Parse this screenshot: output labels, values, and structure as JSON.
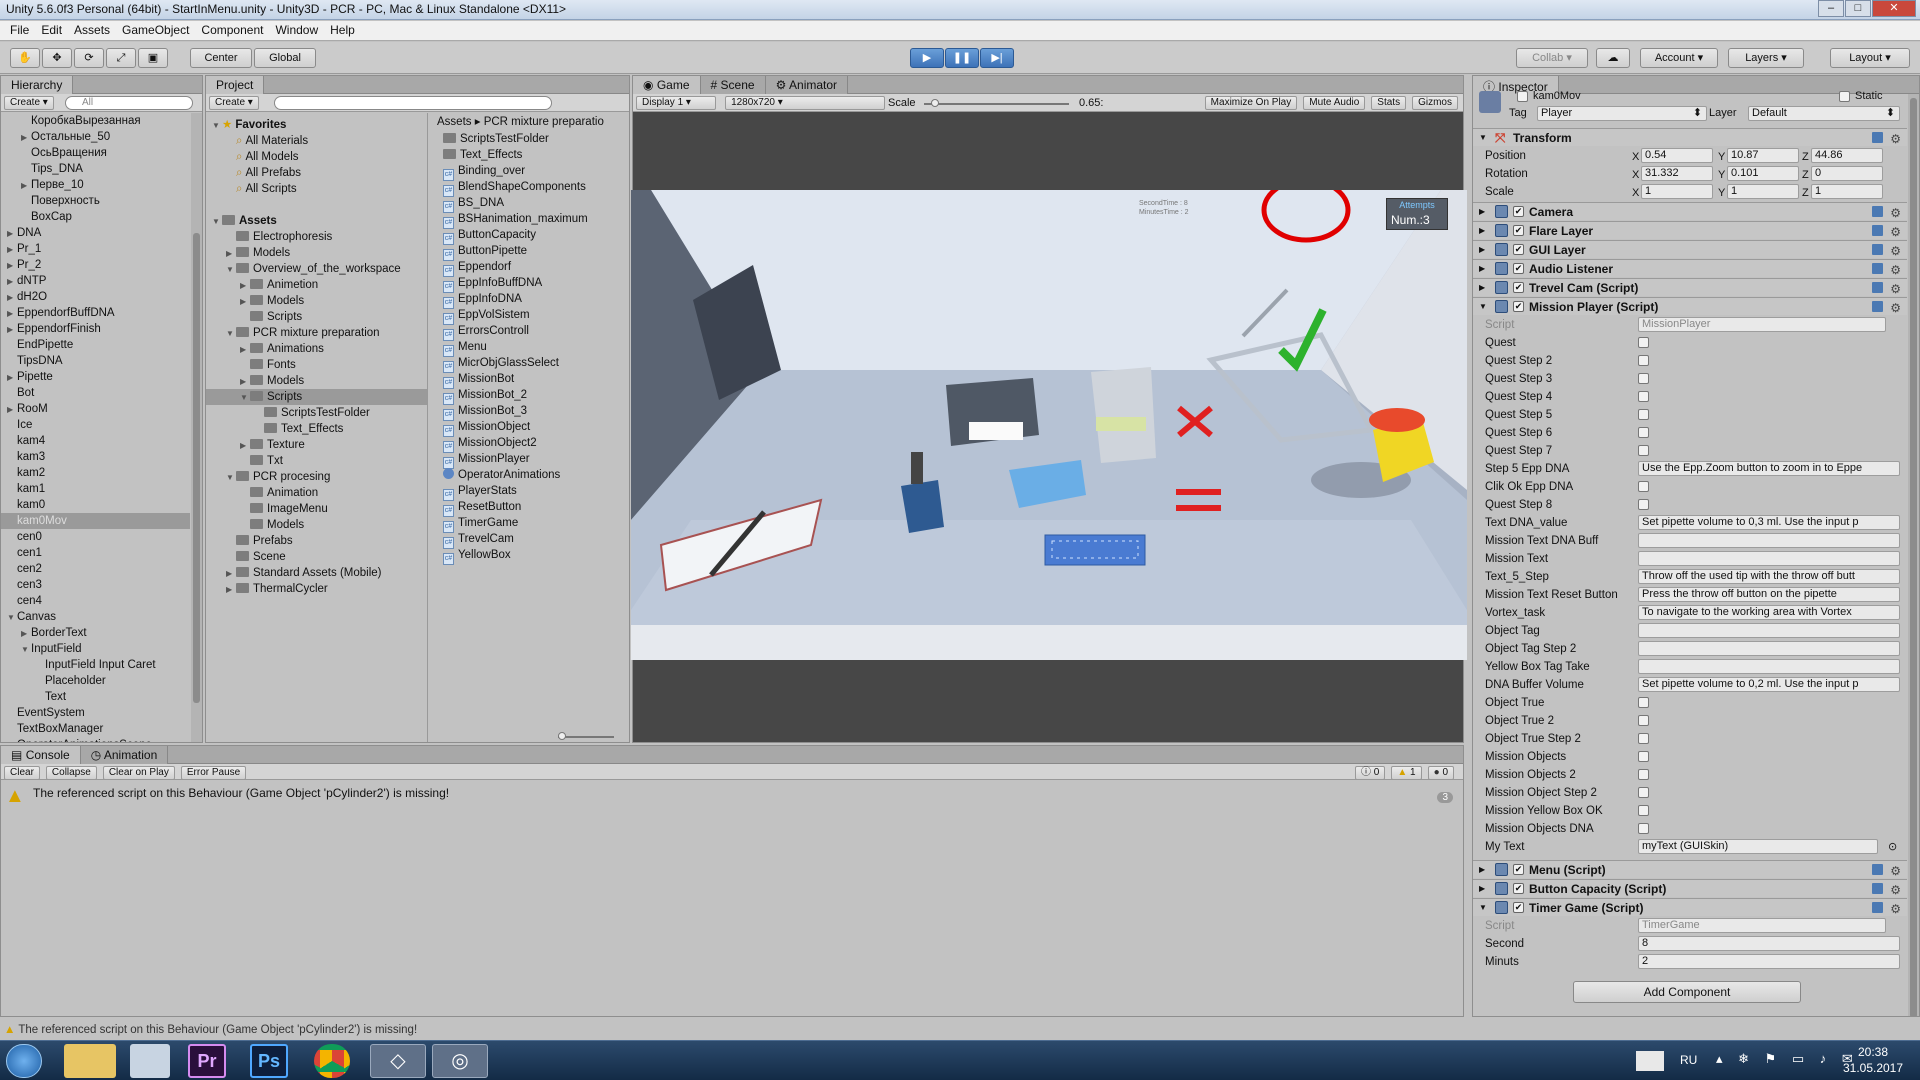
{
  "window": {
    "title": "Unity 5.6.0f3 Personal (64bit) - StartInMenu.unity - Unity3D - PCR - PC, Mac & Linux Standalone <DX11>"
  },
  "menu": [
    "File",
    "Edit",
    "Assets",
    "GameObject",
    "Component",
    "Window",
    "Help"
  ],
  "toolbar": {
    "center": "Center",
    "global": "Global",
    "collab": "Collab",
    "account": "Account",
    "layers": "Layers",
    "layout": "Layout",
    "icons": {
      "play": "play-icon",
      "pause": "pause-icon",
      "step": "step-icon"
    }
  },
  "hierarchy": {
    "tab": "Hierarchy",
    "create": "Create",
    "search": "All",
    "items": [
      {
        "label": "КоробкаВырезанная",
        "indent": 2,
        "arrow": false
      },
      {
        "label": "Остальные_50",
        "indent": 2,
        "arrow": true
      },
      {
        "label": "ОсьВращения",
        "indent": 2,
        "arrow": false
      },
      {
        "label": "Tips_DNA",
        "indent": 2,
        "arrow": false
      },
      {
        "label": "Перве_10",
        "indent": 2,
        "arrow": true
      },
      {
        "label": "Поверхность",
        "indent": 2,
        "arrow": false
      },
      {
        "label": "BoxCap",
        "indent": 2,
        "arrow": false
      },
      {
        "label": "DNA",
        "indent": 1,
        "arrow": true
      },
      {
        "label": "Pr_1",
        "indent": 1,
        "arrow": true
      },
      {
        "label": "Pr_2",
        "indent": 1,
        "arrow": true
      },
      {
        "label": "dNTP",
        "indent": 1,
        "arrow": true
      },
      {
        "label": "dH2O",
        "indent": 1,
        "arrow": true
      },
      {
        "label": "EppendorfBuffDNA",
        "indent": 1,
        "arrow": true
      },
      {
        "label": "EppendorfFinish",
        "indent": 1,
        "arrow": true
      },
      {
        "label": "EndPipette",
        "indent": 1,
        "arrow": false
      },
      {
        "label": "TipsDNA",
        "indent": 1,
        "arrow": false
      },
      {
        "label": "Pipette",
        "indent": 1,
        "arrow": true
      },
      {
        "label": "Bot",
        "indent": 1,
        "arrow": false
      },
      {
        "label": "RooM",
        "indent": 1,
        "arrow": true
      },
      {
        "label": "Ice",
        "indent": 1,
        "arrow": false
      },
      {
        "label": "kam4",
        "indent": 1,
        "arrow": false
      },
      {
        "label": "kam3",
        "indent": 1,
        "arrow": false
      },
      {
        "label": "kam2",
        "indent": 1,
        "arrow": false
      },
      {
        "label": "kam1",
        "indent": 1,
        "arrow": false
      },
      {
        "label": "kam0",
        "indent": 1,
        "arrow": false
      },
      {
        "label": "kam0Mov",
        "indent": 1,
        "arrow": false,
        "selected": true
      },
      {
        "label": "cen0",
        "indent": 1,
        "arrow": false
      },
      {
        "label": "cen1",
        "indent": 1,
        "arrow": false
      },
      {
        "label": "cen2",
        "indent": 1,
        "arrow": false
      },
      {
        "label": "cen3",
        "indent": 1,
        "arrow": false
      },
      {
        "label": "cen4",
        "indent": 1,
        "arrow": false
      },
      {
        "label": "Canvas",
        "indent": 1,
        "arrow": true,
        "open": true
      },
      {
        "label": "BorderText",
        "indent": 2,
        "arrow": true
      },
      {
        "label": "InputField",
        "indent": 2,
        "arrow": true,
        "open": true
      },
      {
        "label": "InputField Input Caret",
        "indent": 3,
        "arrow": false
      },
      {
        "label": "Placeholder",
        "indent": 3,
        "arrow": false
      },
      {
        "label": "Text",
        "indent": 3,
        "arrow": false
      },
      {
        "label": "EventSystem",
        "indent": 1,
        "arrow": false
      },
      {
        "label": "TextBoxManager",
        "indent": 1,
        "arrow": false
      },
      {
        "label": "OperatorAnimationsScene",
        "indent": 1,
        "arrow": false
      }
    ]
  },
  "project": {
    "tab": "Project",
    "create": "Create",
    "tree": [
      {
        "label": "Favorites",
        "indent": 0,
        "type": "star",
        "bold": true,
        "arrow": true,
        "open": true
      },
      {
        "label": "All Materials",
        "indent": 1,
        "type": "search"
      },
      {
        "label": "All Models",
        "indent": 1,
        "type": "search"
      },
      {
        "label": "All Prefabs",
        "indent": 1,
        "type": "search"
      },
      {
        "label": "All Scripts",
        "indent": 1,
        "type": "search"
      },
      {
        "label": "",
        "indent": 0,
        "type": "blank"
      },
      {
        "label": "Assets",
        "indent": 0,
        "type": "folder",
        "bold": true,
        "arrow": true,
        "open": true
      },
      {
        "label": "Electrophoresis",
        "indent": 1,
        "type": "folder"
      },
      {
        "label": "Models",
        "indent": 1,
        "type": "folder",
        "arrow": true
      },
      {
        "label": "Overview_of_the_workspace",
        "indent": 1,
        "type": "folder",
        "arrow": true,
        "open": true
      },
      {
        "label": "Animetion",
        "indent": 2,
        "type": "folder",
        "arrow": true
      },
      {
        "label": "Models",
        "indent": 2,
        "type": "folder",
        "arrow": true
      },
      {
        "label": "Scripts",
        "indent": 2,
        "type": "folder"
      },
      {
        "label": "PCR mixture preparation",
        "indent": 1,
        "type": "folder",
        "arrow": true,
        "open": true
      },
      {
        "label": "Animations",
        "indent": 2,
        "type": "folder",
        "arrow": true
      },
      {
        "label": "Fonts",
        "indent": 2,
        "type": "folder"
      },
      {
        "label": "Models",
        "indent": 2,
        "type": "folder",
        "arrow": true
      },
      {
        "label": "Scripts",
        "indent": 2,
        "type": "folder",
        "arrow": true,
        "open": true,
        "selected": true
      },
      {
        "label": "ScriptsTestFolder",
        "indent": 3,
        "type": "folder"
      },
      {
        "label": "Text_Effects",
        "indent": 3,
        "type": "folder"
      },
      {
        "label": "Texture",
        "indent": 2,
        "type": "folder",
        "arrow": true
      },
      {
        "label": "Txt",
        "indent": 2,
        "type": "folder"
      },
      {
        "label": "PCR procesing",
        "indent": 1,
        "type": "folder",
        "arrow": true,
        "open": true
      },
      {
        "label": "Animation",
        "indent": 2,
        "type": "folder"
      },
      {
        "label": "ImageMenu",
        "indent": 2,
        "type": "folder"
      },
      {
        "label": "Models",
        "indent": 2,
        "type": "folder"
      },
      {
        "label": "Prefabs",
        "indent": 1,
        "type": "folder"
      },
      {
        "label": "Scene",
        "indent": 1,
        "type": "folder"
      },
      {
        "label": "Standard Assets (Mobile)",
        "indent": 1,
        "type": "folder",
        "arrow": true
      },
      {
        "label": "ThermalCycler",
        "indent": 1,
        "type": "folder",
        "arrow": true
      }
    ],
    "breadcrumb": [
      "Assets",
      "PCR mixture preparatio"
    ],
    "files": [
      {
        "label": "ScriptsTestFolder",
        "type": "folder"
      },
      {
        "label": "Text_Effects",
        "type": "folder"
      },
      {
        "label": "Binding_over",
        "type": "script"
      },
      {
        "label": "BlendShapeComponents",
        "type": "script"
      },
      {
        "label": "BS_DNA",
        "type": "script"
      },
      {
        "label": "BSHanimation_maximum",
        "type": "script"
      },
      {
        "label": "ButtonCapacity",
        "type": "script"
      },
      {
        "label": "ButtonPipette",
        "type": "script"
      },
      {
        "label": "Eppendorf",
        "type": "script"
      },
      {
        "label": "EppInfoBuffDNA",
        "type": "script"
      },
      {
        "label": "EppInfoDNA",
        "type": "script"
      },
      {
        "label": "EppVolSistem",
        "type": "script"
      },
      {
        "label": "ErrorsControll",
        "type": "script"
      },
      {
        "label": "Menu",
        "type": "script"
      },
      {
        "label": "MicrObjGlassSelect",
        "type": "script"
      },
      {
        "label": "MissionBot",
        "type": "script"
      },
      {
        "label": "MissionBot_2",
        "type": "script"
      },
      {
        "label": "MissionBot_3",
        "type": "script"
      },
      {
        "label": "MissionObject",
        "type": "script"
      },
      {
        "label": "MissionObject2",
        "type": "script"
      },
      {
        "label": "MissionPlayer",
        "type": "script"
      },
      {
        "label": "OperatorAnimations",
        "type": "anim"
      },
      {
        "label": "PlayerStats",
        "type": "script"
      },
      {
        "label": "ResetButton",
        "type": "script"
      },
      {
        "label": "TimerGame",
        "type": "script"
      },
      {
        "label": "TrevelCam",
        "type": "script"
      },
      {
        "label": "YellowBox",
        "type": "script"
      }
    ]
  },
  "game": {
    "tabs": [
      "Game",
      "Scene",
      "Animator"
    ],
    "display": "Display 1",
    "resolution": "1280x720",
    "scale_label": "Scale",
    "scale_value": "0.65:",
    "scale_level": 0.05,
    "buttons": [
      "Maximize On Play",
      "Mute Audio",
      "Stats",
      "Gizmos"
    ],
    "hud": {
      "second": "SecondTime : 8",
      "minutes": "MinutesTime : 2",
      "attempts": "Attempts",
      "num": "Num.:3"
    }
  },
  "inspector": {
    "tab": "Inspector",
    "object": "kam0Mov",
    "static": "Static",
    "tag_label": "Tag",
    "tag": "Player",
    "layer_label": "Layer",
    "layer": "Default",
    "transform": {
      "title": "Transform",
      "position": {
        "label": "Position",
        "x": "0.54",
        "y": "10.87",
        "z": "44.86"
      },
      "rotation": {
        "label": "Rotation",
        "x": "31.332",
        "y": "0.101",
        "z": "0"
      },
      "scale": {
        "label": "Scale",
        "x": "1",
        "y": "1",
        "z": "1"
      }
    },
    "components_a": [
      "Camera",
      "Flare Layer",
      "GUI Layer",
      "Audio Listener",
      "Trevel Cam (Script)"
    ],
    "mission": {
      "title": "Mission Player (Script)",
      "script_label": "Script",
      "script": "MissionPlayer",
      "fields": [
        {
          "label": "Quest",
          "type": "check"
        },
        {
          "label": "Quest Step 2",
          "type": "check"
        },
        {
          "label": "Quest Step 3",
          "type": "check"
        },
        {
          "label": "Quest Step 4",
          "type": "check"
        },
        {
          "label": "Quest Step 5",
          "type": "check"
        },
        {
          "label": "Quest Step 6",
          "type": "check"
        },
        {
          "label": "Quest Step 7",
          "type": "check"
        },
        {
          "label": "Step 5 Epp DNA",
          "type": "text",
          "value": "Use the Epp.Zoom button to zoom in to Eppe"
        },
        {
          "label": "Clik Ok Epp DNA",
          "type": "check"
        },
        {
          "label": "Quest Step 8",
          "type": "check"
        },
        {
          "label": "Text DNA_value",
          "type": "text",
          "value": "Set pipette volume to 0,3 ml. Use the input p"
        },
        {
          "label": "Mission Text DNA Buff",
          "type": "text",
          "value": ""
        },
        {
          "label": "Mission Text",
          "type": "text",
          "value": ""
        },
        {
          "label": "Text_5_Step",
          "type": "text",
          "value": "Throw off the used tip with the throw off butt"
        },
        {
          "label": "Mission Text Reset Button",
          "type": "text",
          "value": "Press the throw off button on the pipette"
        },
        {
          "label": "Vortex_task",
          "type": "text",
          "value": "To navigate to the working area with Vortex"
        },
        {
          "label": "Object Tag",
          "type": "text",
          "value": ""
        },
        {
          "label": "Object Tag Step 2",
          "type": "text",
          "value": ""
        },
        {
          "label": "Yellow Box Tag Take",
          "type": "text",
          "value": ""
        },
        {
          "label": "DNA Buffer Volume",
          "type": "text",
          "value": "Set pipette volume to 0,2 ml. Use the input p"
        },
        {
          "label": "Object True",
          "type": "check"
        },
        {
          "label": "Object True 2",
          "type": "check"
        },
        {
          "label": "Object True Step 2",
          "type": "check"
        },
        {
          "label": "Mission Objects",
          "type": "check"
        },
        {
          "label": "Mission Objects 2",
          "type": "check"
        },
        {
          "label": "Mission Object Step 2",
          "type": "check"
        },
        {
          "label": "Mission Yellow Box OK",
          "type": "check"
        },
        {
          "label": "Mission Objects DNA",
          "type": "check"
        },
        {
          "label": "My Text",
          "type": "obj",
          "value": "myText (GUISkin)"
        }
      ]
    },
    "components_b": [
      "Menu (Script)",
      "Button Capacity (Script)"
    ],
    "timer": {
      "title": "Timer Game (Script)",
      "script_label": "Script",
      "script": "TimerGame",
      "second_label": "Second",
      "second": "8",
      "minutes_label": "Minuts",
      "minutes": "2"
    },
    "add_component": "Add Component"
  },
  "console": {
    "tabs": [
      "Console",
      "Animation"
    ],
    "buttons": [
      "Clear",
      "Collapse",
      "Clear on Play",
      "Error Pause"
    ],
    "counts": {
      "info": "0",
      "warn": "1",
      "error": "0"
    },
    "message": "The referenced script on this Behaviour (Game Object 'pCylinder2') is missing!",
    "count": "3"
  },
  "statusbar": {
    "message": "The referenced script on this Behaviour (Game Object 'pCylinder2') is missing!"
  },
  "taskbar": {
    "apps": [
      "start-orb-icon",
      "explorer-icon",
      "calculator-icon",
      "premiere-icon",
      "photoshop-icon",
      "chrome-icon",
      "unity-icon",
      "unity-hub-icon"
    ],
    "app_text": {
      "pr": "Pr",
      "ps": "Ps"
    },
    "lang": "RU",
    "time": "20:38",
    "date": "31.05.2017"
  }
}
